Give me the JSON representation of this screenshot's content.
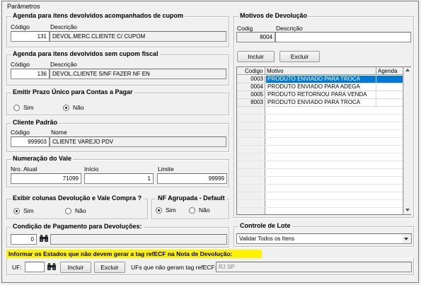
{
  "window_title": "Parâmetros",
  "agenda_com_cupom": {
    "title": "Agenda para itens devolvidos acompanhados de cupom",
    "codigo_label": "Código",
    "descricao_label": "Descrição",
    "codigo": "131",
    "descricao": "DEVOL.MERC.CLIENTE C/ CUPOM"
  },
  "agenda_sem_cupom": {
    "title": "Agenda para itens devolvidos sem cupom fiscal",
    "codigo_label": "Código",
    "descricao_label": "Descrição",
    "codigo": "136",
    "descricao": "DEVOL.CLIENTE S/NF FAZER NF EN"
  },
  "prazo_unico": {
    "title": "Emitir Prazo Único para Contas a Pagar",
    "sim": "Sim",
    "nao": "Não",
    "selected": "Não"
  },
  "cliente_padrao": {
    "title": "Cliente Padrão",
    "codigo_label": "Código",
    "nome_label": "Nome",
    "codigo": "999903",
    "nome": "CLIENTE VAREJO PDV"
  },
  "numeracao_vale": {
    "title": "Numeração do Vale",
    "atual_label": "Nro. Atual",
    "inicio_label": "Início",
    "limite_label": "Limite",
    "atual": "71099",
    "inicio": "1",
    "limite": "99999"
  },
  "exibir_colunas": {
    "title": "Exibir colunas Devolução e Vale Compra ?",
    "sim": "Sim",
    "nao": "Não",
    "selected": "Sim"
  },
  "nf_agrupada": {
    "title": "NF Agrupada - Default",
    "sim": "Sim",
    "nao": "Não",
    "selected": "Sim"
  },
  "condicao_pagamento": {
    "title": "Condição de Pagamento para Devoluções:",
    "codigo": "0",
    "descricao": ""
  },
  "motivos": {
    "title": "Motivos de Devolução",
    "codigo_label": "Codig",
    "descricao_label": "Descrição",
    "codigo": "8004",
    "descricao": "",
    "incluir": "Incluir",
    "excluir": "Excluir",
    "columns": [
      "Codigo",
      "Motivo",
      "Agenda"
    ],
    "rows": [
      {
        "codigo": "0003",
        "motivo": "PRODUTO ENVIADO PARA TROCA",
        "agenda": ""
      },
      {
        "codigo": "0004",
        "motivo": "PRODUTO ENVIADO PARA ADEGA",
        "agenda": ""
      },
      {
        "codigo": "0005",
        "motivo": "PRODUTO RETORNOU PARA VENDA",
        "agenda": ""
      },
      {
        "codigo": "8003",
        "motivo": "PRODUTO ENVIADO PARA TROCA",
        "agenda": ""
      }
    ],
    "selected_row": 0
  },
  "controle_lote": {
    "title": "Controle de Lote",
    "value": "Validar Todos os Itens"
  },
  "estados": {
    "title": "Informar os Estados que não devem gerar a tag refECF na Nota de Devolução:",
    "uf_label": "UF:",
    "uf_value": "",
    "incluir": "Incluir",
    "excluir": "Excluir",
    "ufs_label": "UFs que não geram tag refECF:",
    "ufs_value": "RJ SP"
  },
  "colors": {
    "highlight": "#fff200",
    "selection": "#0078d7",
    "border": "#bdbdbd"
  }
}
